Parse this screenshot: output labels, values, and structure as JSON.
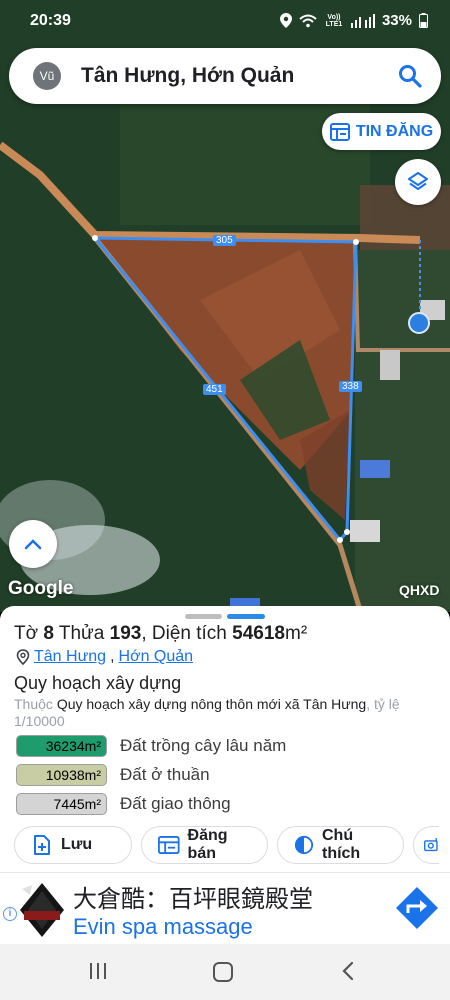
{
  "status_bar": {
    "time": "20:39",
    "network_label": "Vo)) LTE1",
    "battery": "33%"
  },
  "search": {
    "avatar_initials": "Vũ",
    "title": "Tân Hưng, Hớn Quản"
  },
  "map": {
    "tin_dang_label": "TIN ĐĂNG",
    "edge_labels": [
      "305",
      "451",
      "338"
    ],
    "google_label": "Google",
    "layer_code": "QHXD"
  },
  "parcel": {
    "prefix_to": "Tờ ",
    "sheet_no": "8",
    "prefix_thua": " Thửa ",
    "parcel_no": "193",
    "prefix_area": ", Diện tích ",
    "area": "54618",
    "unit": "m²",
    "location_commune": "Tân Hưng",
    "location_sep": ", ",
    "location_district": "Hớn Quản"
  },
  "planning": {
    "heading": "Quy hoạch xây dựng",
    "desc_prefix": "Thuộc ",
    "desc_name": "Quy hoạch xây dựng nông thôn mới xã Tân Hưng",
    "desc_suffix": ", tỷ lệ 1/10000",
    "legend": [
      {
        "value": "36234m²",
        "label": "Đất trồng cây lâu năm",
        "color": "#1e9c6d"
      },
      {
        "value": "10938m²",
        "label": "Đất ở thuần",
        "color": "#c9cda4"
      },
      {
        "value": "7445m²",
        "label": "Đất giao thông",
        "color": "#d4d4d4"
      }
    ]
  },
  "actions": {
    "save": "Lưu",
    "post": "Đăng bán",
    "note": "Chú thích"
  },
  "ad": {
    "title": "大倉酷：百坪眼鏡殿堂",
    "subtitle": "Evin spa massage",
    "info_glyph": "i"
  },
  "colors": {
    "accent": "#1a73e8",
    "boundary": "#3d8ef0"
  }
}
